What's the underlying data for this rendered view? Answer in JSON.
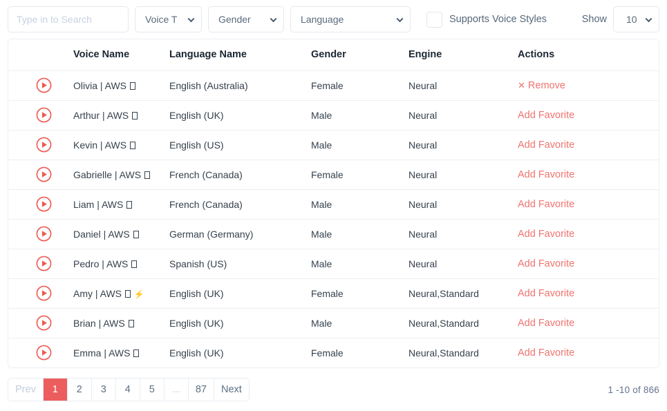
{
  "toolbar": {
    "search_placeholder": "Type in to Search",
    "search_value": "",
    "voice_type_label": "Voice T",
    "gender_label": "Gender",
    "language_label": "Language",
    "supports_voice_styles_label": "Supports Voice Styles",
    "supports_voice_styles_checked": false,
    "show_label": "Show",
    "show_value": "10"
  },
  "table": {
    "columns": [
      "",
      "Voice Name",
      "Language Name",
      "Gender",
      "Engine",
      "Actions"
    ],
    "rows": [
      {
        "play": "play-icon",
        "name": "Olivia | AWS ⎕",
        "language": "English (Australia)",
        "gender": "Female",
        "engine": "Neural",
        "action": "Remove",
        "action_type": "remove"
      },
      {
        "play": "play-icon",
        "name": "Arthur | AWS ⎕",
        "language": "English (UK)",
        "gender": "Male",
        "engine": "Neural",
        "action": "Add Favorite",
        "action_type": "add"
      },
      {
        "play": "play-icon",
        "name": "Kevin | AWS ⎕",
        "language": "English (US)",
        "gender": "Male",
        "engine": "Neural",
        "action": "Add Favorite",
        "action_type": "add"
      },
      {
        "play": "play-icon",
        "name": "Gabrielle | AWS ⎕",
        "language": "French (Canada)",
        "gender": "Female",
        "engine": "Neural",
        "action": "Add Favorite",
        "action_type": "add"
      },
      {
        "play": "play-icon",
        "name": "Liam | AWS ⎕",
        "language": "French (Canada)",
        "gender": "Male",
        "engine": "Neural",
        "action": "Add Favorite",
        "action_type": "add"
      },
      {
        "play": "play-icon",
        "name": "Daniel | AWS ⎕",
        "language": "German (Germany)",
        "gender": "Male",
        "engine": "Neural",
        "action": "Add Favorite",
        "action_type": "add"
      },
      {
        "play": "play-icon",
        "name": "Pedro | AWS ⎕",
        "language": "Spanish (US)",
        "gender": "Male",
        "engine": "Neural",
        "action": "Add Favorite",
        "action_type": "add"
      },
      {
        "play": "play-icon",
        "name": "Amy | AWS ⎕ ⚡",
        "language": "English (UK)",
        "gender": "Female",
        "engine": "Neural,Standard",
        "action": "Add Favorite",
        "action_type": "add"
      },
      {
        "play": "play-icon",
        "name": "Brian | AWS ⎕",
        "language": "English (UK)",
        "gender": "Male",
        "engine": "Neural,Standard",
        "action": "Add Favorite",
        "action_type": "add"
      },
      {
        "play": "play-icon",
        "name": "Emma | AWS ⎕",
        "language": "English (UK)",
        "gender": "Female",
        "engine": "Neural,Standard",
        "action": "Add Favorite",
        "action_type": "add"
      }
    ]
  },
  "pagination": {
    "prev_label": "Prev",
    "next_label": "Next",
    "pages": [
      "1",
      "2",
      "3",
      "4",
      "5",
      "...",
      "87"
    ],
    "active_page": "1",
    "range_text": "1 -10 of 866"
  },
  "colors": {
    "accent": "#ec5d5d",
    "link": "#f0736e",
    "border": "#eceff4",
    "text": "#36414d"
  }
}
